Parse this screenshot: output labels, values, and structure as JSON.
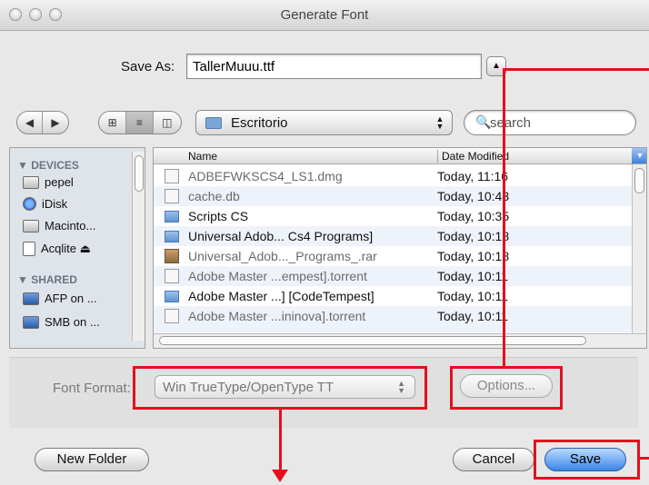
{
  "window": {
    "title": "Generate Font"
  },
  "save_as": {
    "label": "Save As:",
    "value": "TallerMuuu.ttf"
  },
  "toolbar": {
    "back_icon": "back-arrow",
    "forward_icon": "forward-arrow",
    "location": "Escritorio",
    "search_placeholder": "search"
  },
  "sidebar": {
    "devices_header": "▼ DEVICES",
    "devices": [
      "pepel",
      "iDisk",
      "Macinto...",
      "Acqlite ⏏"
    ],
    "shared_header": "▼ SHARED",
    "shared": [
      "AFP on ...",
      "SMB on ..."
    ]
  },
  "files": {
    "col_name": "Name",
    "col_date": "Date Modified",
    "rows": [
      {
        "name": "ADBEFWKSCS4_LS1.dmg",
        "date": "Today, 11:16"
      },
      {
        "name": "cache.db",
        "date": "Today, 10:43"
      },
      {
        "name": "Scripts CS",
        "date": "Today, 10:35"
      },
      {
        "name": "Universal Adob... Cs4 Programs]",
        "date": "Today, 10:18"
      },
      {
        "name": "Universal_Adob..._Programs_.rar",
        "date": "Today, 10:18"
      },
      {
        "name": "Adobe Master ...empest].torrent",
        "date": "Today, 10:11"
      },
      {
        "name": "Adobe Master ...] [CodeTempest]",
        "date": "Today, 10:11"
      },
      {
        "name": "Adobe Master ...ininova].torrent",
        "date": "Today, 10:11"
      }
    ]
  },
  "options": {
    "font_format_label": "Font Format:",
    "font_format_value": "Win TrueType/OpenType TT",
    "options_button": "Options..."
  },
  "buttons": {
    "new_folder": "New Folder",
    "cancel": "Cancel",
    "save": "Save"
  },
  "colors": {
    "annotation": "#e3101f",
    "accent": "#3c86e6"
  }
}
